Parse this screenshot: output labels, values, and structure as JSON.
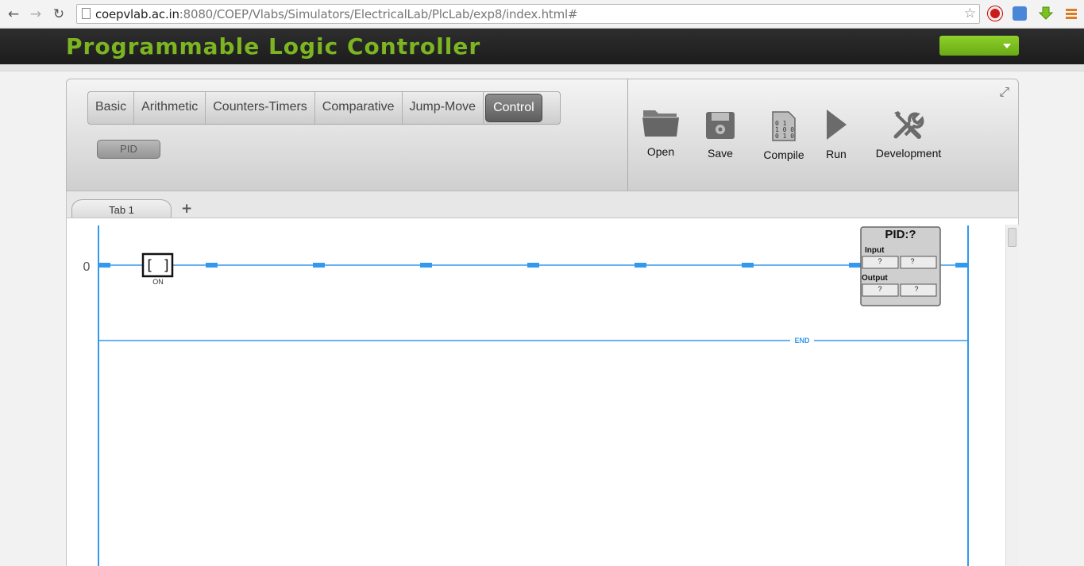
{
  "browser": {
    "url_host": "coepvlab.ac.in",
    "url_rest": ":8080/COEP/Vlabs/Simulators/ElectricalLab/PlcLab/exp8/index.html#",
    "back_icon": "back-arrow-icon",
    "forward_icon": "forward-arrow-icon",
    "reload_icon": "reload-icon"
  },
  "app": {
    "title": "Programmable Logic Controller",
    "accent_color": "#7cb521"
  },
  "categories": {
    "tabs": [
      "Basic",
      "Arithmetic",
      "Counters-Timers",
      "Comparative",
      "Jump-Move",
      "Control"
    ],
    "active": "Control"
  },
  "instructions": {
    "pid_label": "PID"
  },
  "tools": {
    "open": "Open",
    "save": "Save",
    "compile": "Compile",
    "run": "Run",
    "development": "Development"
  },
  "doc_tabs": {
    "tab1": "Tab 1",
    "add": "+"
  },
  "ladder": {
    "rung_number": "0",
    "contact_symbol": "[ ]",
    "contact_label": "ON",
    "pid_block": {
      "title": "PID:?",
      "input_label": "Input",
      "output_label": "Output",
      "input_1": "?",
      "input_2": "?",
      "output_1": "?",
      "output_2": "?"
    },
    "end_label": "END",
    "rail_color": "#3399ee"
  }
}
